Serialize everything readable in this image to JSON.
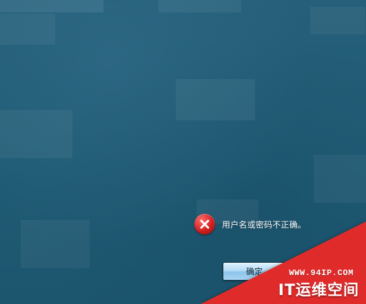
{
  "dialog": {
    "message": "用户名或密码不正确。",
    "ok_label": "确定",
    "icon": "error-icon"
  },
  "watermark": {
    "url": "WWW.94IP.COM",
    "brand": "IT运维空间"
  },
  "colors": {
    "background": "#1f5f7a",
    "error_red": "#d21f1f",
    "button_blue": "#b7dcf6",
    "watermark_red": "#e02b2b"
  }
}
